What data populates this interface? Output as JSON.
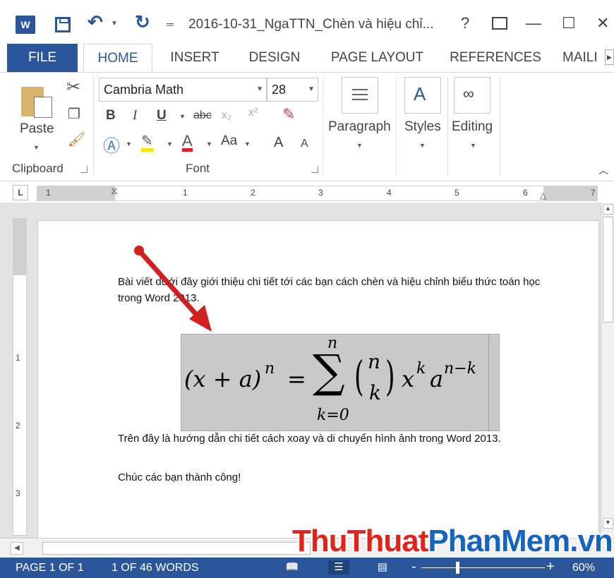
{
  "window": {
    "title": "2016-10-31_NgaTTN_Chèn và hiệu chỉ...",
    "help": "?",
    "min": "—",
    "max": "☐",
    "close": "✕"
  },
  "tabs": [
    {
      "label": "FILE"
    },
    {
      "label": "HOME"
    },
    {
      "label": "INSERT"
    },
    {
      "label": "DESIGN"
    },
    {
      "label": "PAGE LAYOUT"
    },
    {
      "label": "REFERENCES"
    },
    {
      "label": "MAILI"
    }
  ],
  "ribbon": {
    "clipboard": {
      "paste_label": "Paste",
      "group_label": "Clipboard"
    },
    "font": {
      "font_name": "Cambria Math",
      "font_size": "28",
      "bold": "B",
      "italic": "I",
      "underline": "U",
      "strike": "abc",
      "subscript": "x₂",
      "superscript": "x²",
      "change_case": "Aa",
      "grow": "A",
      "shrink": "A",
      "group_label": "Font"
    },
    "paragraph_label": "Paragraph",
    "styles_label": "Styles",
    "editing_label": "Editing"
  },
  "ruler": {
    "corner": "L",
    "numbers": [
      "1",
      "1",
      "2",
      "3",
      "4",
      "5",
      "6",
      "7"
    ],
    "vnumbers": [
      "1",
      "2",
      "3"
    ]
  },
  "document": {
    "para1": "Bài viết dưới đây giới thiệu chi tiết tới các bạn cách chèn và hiệu chỉnh biểu thức toán học trong Word 2013.",
    "equation": {
      "lhs": "(x + a)",
      "lhs_exp": "n",
      "eq": "=",
      "sum_upper": "n",
      "sum_lower": "k=0",
      "binom_top": "n",
      "binom_bottom": "k",
      "x": "x",
      "x_exp": "k",
      "a": "a",
      "a_exp": "n−k"
    },
    "para2": "Trên đây là hướng dẫn chi tiết cách xoay và di chuyển hình ảnh trong Word 2013.",
    "para3": "Chúc các bạn thành công!"
  },
  "status": {
    "page": "PAGE 1 OF 1",
    "words": "1 OF 46 WORDS",
    "zoom_minus": "-",
    "zoom_plus": "+",
    "zoom": "60%"
  },
  "zoom_level_percent": 60,
  "watermark": {
    "part1": "ThuThuat",
    "part2": "PhanMem",
    "part3": ".vn"
  },
  "colors": {
    "brand": "#2b579a",
    "arrow": "#d11f22",
    "watermark_red": "#e2231a",
    "watermark_blue": "#1565c0"
  }
}
